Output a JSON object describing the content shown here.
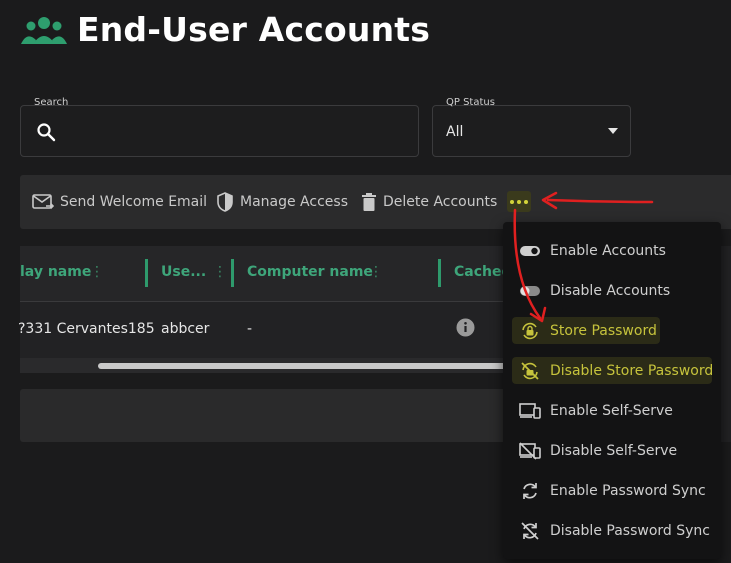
{
  "header": {
    "title": "End-User Accounts",
    "icon": "users-icon"
  },
  "search": {
    "label": "Search",
    "placeholder": "",
    "value": ""
  },
  "qp_status": {
    "label": "QP Status",
    "value": "All"
  },
  "toolbar": {
    "send_welcome": "Send Welcome Email",
    "manage_access": "Manage Access",
    "delete_accounts": "Delete Accounts"
  },
  "table": {
    "columns": [
      "lay name",
      "Use...",
      "Computer name",
      "Cached"
    ],
    "rows": [
      {
        "display_name": "?331 Cervantes185",
        "username": "abbcer",
        "computer_name": "-"
      }
    ]
  },
  "menu": {
    "items": [
      {
        "label": "Enable Accounts",
        "icon": "toggle-on-icon"
      },
      {
        "label": "Disable Accounts",
        "icon": "toggle-off-icon"
      },
      {
        "label": "Store Password",
        "icon": "lock-sync-icon"
      },
      {
        "label": "Disable Store Password",
        "icon": "lock-sync-off-icon"
      },
      {
        "label": "Enable Self-Serve",
        "icon": "devices-icon"
      },
      {
        "label": "Disable Self-Serve",
        "icon": "devices-off-icon"
      },
      {
        "label": "Enable Password Sync",
        "icon": "sync-icon"
      },
      {
        "label": "Disable Password Sync",
        "icon": "sync-off-icon"
      }
    ]
  },
  "colors": {
    "accent_green": "#3ea57a",
    "highlight_yellow": "#c6c33c",
    "annotation_red": "#e02020",
    "background": "#1b1b1c"
  }
}
